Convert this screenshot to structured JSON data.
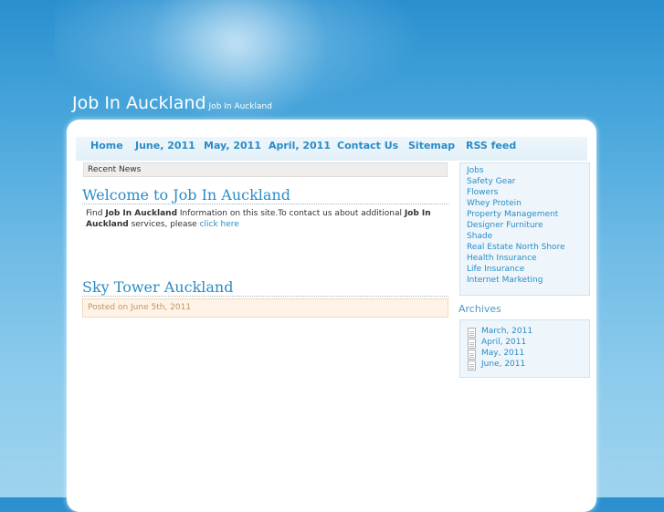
{
  "header": {
    "title": "Job In Auckland",
    "description": "Job In Auckland"
  },
  "nav": {
    "items": [
      "Home",
      "June, 2011",
      "May, 2011",
      "April, 2011",
      "Contact Us",
      "Sitemap",
      "RSS feed"
    ]
  },
  "main": {
    "recent_news_label": "Recent News",
    "post1": {
      "title": "Welcome to Job In Auckland",
      "text_find": "Find ",
      "text_bold1": "Job In Auckland",
      "text_mid": " Information on this site.To contact us about additional ",
      "text_bold2": "Job In Auckland",
      "text_end": " services, please ",
      "link": "click here"
    },
    "post2": {
      "title": "Sky Tower Auckland",
      "meta": "Posted on June 5th, 2011"
    }
  },
  "sidebar": {
    "links": [
      "Jobs",
      "Safety Gear",
      "Flowers",
      "Whey Protein",
      "Property Management",
      "Designer Furniture",
      "Shade",
      "Real Estate North Shore",
      "Health Insurance",
      "Life Insurance",
      "Internet Marketing"
    ],
    "archives_heading": "Archives",
    "archives": [
      "March, 2011",
      "April, 2011",
      "May, 2011",
      "June, 2011"
    ]
  },
  "colors": {
    "link": "#2a8cc7",
    "background_top": "#2a8fcf",
    "background_bottom": "#9fd3ee"
  }
}
